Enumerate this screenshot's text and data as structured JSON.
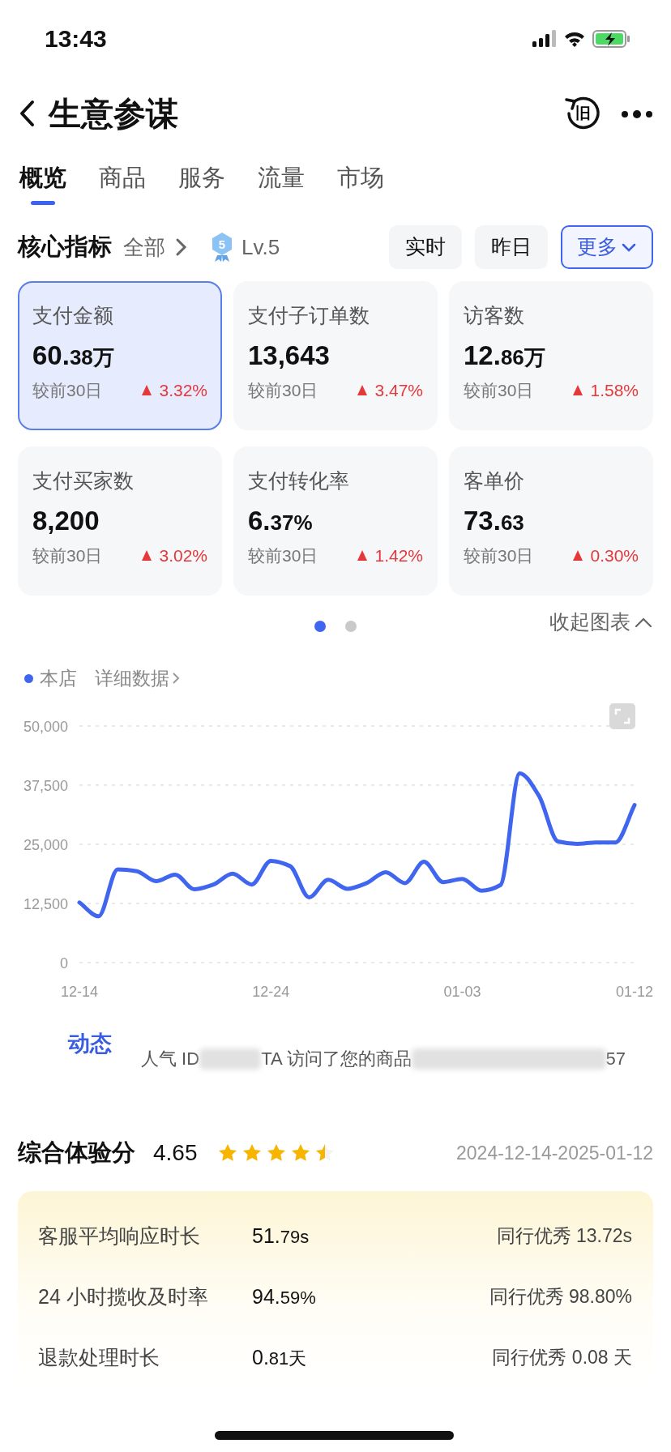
{
  "status_bar": {
    "time": "13:43"
  },
  "header": {
    "title": "生意参谋",
    "old_version_label": "旧"
  },
  "tabs": [
    {
      "label": "概览",
      "selected": true
    },
    {
      "label": "商品",
      "selected": false
    },
    {
      "label": "服务",
      "selected": false
    },
    {
      "label": "流量",
      "selected": false
    },
    {
      "label": "市场",
      "selected": false
    }
  ],
  "metrics_header": {
    "title": "核心指标",
    "scope": "全部",
    "level_number": "5",
    "level": "Lv.5",
    "periods": [
      {
        "label": "实时",
        "kind": "toggle",
        "selected": false
      },
      {
        "label": "昨日",
        "kind": "toggle",
        "selected": false
      },
      {
        "label": "更多",
        "kind": "dropdown",
        "selected": true
      }
    ]
  },
  "metric_cards": [
    {
      "name": "支付金额",
      "value": "60.38万",
      "compare": "较前30日",
      "change": "3.32%",
      "selected": true
    },
    {
      "name": "支付子订单数",
      "value": "13,643",
      "compare": "较前30日",
      "change": "3.47%",
      "selected": false
    },
    {
      "name": "访客数",
      "value": "12.86万",
      "compare": "较前30日",
      "change": "1.58%",
      "selected": false
    },
    {
      "name": "支付买家数",
      "value": "8,200",
      "compare": "较前30日",
      "change": "3.02%",
      "selected": false
    },
    {
      "name": "支付转化率",
      "value": "6.37%",
      "compare": "较前30日",
      "change": "1.42%",
      "selected": false
    },
    {
      "name": "客单价",
      "value": "73.63",
      "compare": "较前30日",
      "change": "0.30%",
      "selected": false
    }
  ],
  "pager": [
    {
      "selected": true
    },
    {
      "selected": false
    }
  ],
  "collapse_label": "收起图表",
  "chart": {
    "details_link": "详细数据",
    "chart_data": {
      "type": "line",
      "categories": [
        "12-14",
        null,
        null,
        null,
        null,
        null,
        null,
        null,
        null,
        null,
        "12-24",
        null,
        null,
        null,
        null,
        null,
        null,
        null,
        null,
        null,
        "01-03",
        null,
        null,
        null,
        null,
        null,
        null,
        null,
        null,
        "01-12"
      ],
      "grid": true,
      "series": [
        {
          "name": "本店",
          "color": "#4066f0",
          "values": [
            12700,
            9800,
            19700,
            19300,
            17200,
            18600,
            15500,
            16500,
            18800,
            16500,
            21500,
            20400,
            13800,
            17500,
            15600,
            16800,
            19100,
            16800,
            21300,
            17000,
            17700,
            15200,
            16400,
            40000,
            35300,
            25600,
            25100,
            25400,
            25400,
            33300
          ]
        }
      ],
      "ylim": [
        0,
        50000
      ],
      "yticks": [
        {
          "value": 0,
          "label": "0"
        },
        {
          "value": 12500,
          "label": "12,500"
        },
        {
          "value": 25000,
          "label": "25,000"
        },
        {
          "value": 37500,
          "label": "37,500"
        },
        {
          "value": 50000,
          "label": "50,000"
        }
      ]
    }
  },
  "activity": {
    "label": "动态",
    "parts": [
      "人气 ID",
      "TA 访问了您的商品",
      "57"
    ]
  },
  "experience": {
    "title": "综合体验分",
    "score": "4.65",
    "stars": 4.5,
    "date_range": "2024-12-14-2025-01-12",
    "rows": [
      {
        "label": "客服平均响应时长",
        "value": "51.79s",
        "peer": "同行优秀 13.72s"
      },
      {
        "label": "24 小时揽收及时率",
        "value": "94.59%",
        "peer": "同行优秀 98.80%"
      },
      {
        "label": "退款处理时长",
        "value": "0.81天",
        "peer": "同行优秀 0.08 天"
      }
    ]
  }
}
